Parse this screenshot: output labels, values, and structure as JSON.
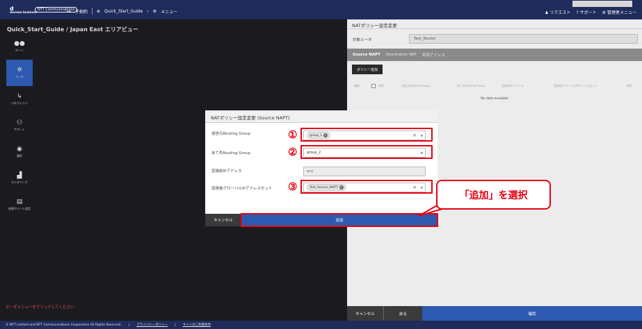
{
  "header": {
    "logo_main": "d",
    "logo_sub": "docomo business",
    "ntt": "NTT Communications",
    "nav": [
      {
        "icon": "network-icon",
        "label": "子契約"
      },
      {
        "icon": "globe-icon",
        "label": "Quick_Start_Guide"
      },
      {
        "icon": "gear-icon",
        "label": "メニュー"
      }
    ],
    "right": [
      {
        "icon": "user-icon",
        "label": "リクエスト"
      },
      {
        "icon": "help-icon",
        "label": "サポート"
      },
      {
        "icon": "settings-icon",
        "label": "管理者メニュー"
      }
    ]
  },
  "main": {
    "title": "Quick_Start_Guide / Japan East エリアビュー",
    "sidebar": [
      {
        "label": "ポート",
        "icon": "port-icon"
      },
      {
        "label": "ルータ",
        "icon": "router-icon",
        "active": true
      },
      {
        "label": "コネクション",
        "icon": "connection-icon"
      },
      {
        "label": "サポート",
        "icon": "support-icon"
      },
      {
        "label": "選択",
        "icon": "select-icon"
      },
      {
        "label": "モニタリング",
        "icon": "monitoring-icon"
      },
      {
        "label": "仮想ポイント設定",
        "icon": "virtual-point-icon"
      }
    ],
    "hint": "ボーダメニューをクリックしてください"
  },
  "right_panel": {
    "title": "NATポリシー設定変更",
    "target_label": "対象ルータ",
    "target_value": "Test_Router",
    "tabs": [
      "Source NAPT",
      "Destination NAT",
      "利用アドレス"
    ],
    "add_policy": "ポリシー追加",
    "columns": [
      "編集",
      "削除",
      "送信元Routing Group",
      "あて先Routing Group",
      "変換前IPアドレス",
      "変換後グローバルIPアドレスセット",
      "操作"
    ],
    "no_data": "No data available",
    "cancel": "キャンセル",
    "back": "戻る",
    "confirm": "確認"
  },
  "modal": {
    "title": "NATポリシー設定変更 (Source NAPT)",
    "rows": [
      {
        "label": "送信元Routing Group",
        "value": "group_1"
      },
      {
        "label": "あて先Routing Group",
        "value": "group_2"
      },
      {
        "label": "変換前IPアドレス",
        "value": "any"
      },
      {
        "label": "変換後グローバルIPアドレスセット",
        "value": "Test_Source_NAPT"
      }
    ],
    "cancel": "キャンセル",
    "add": "追加"
  },
  "annotation": {
    "numbers": [
      "①",
      "②",
      "③"
    ],
    "callout": "「追加」を選択"
  },
  "footer": {
    "copyright": "© NTT Limited and NTT Communications Corporation All Rights Reserved.",
    "links": [
      "プライバシーポリシー",
      "サイトのご利用条件"
    ]
  }
}
